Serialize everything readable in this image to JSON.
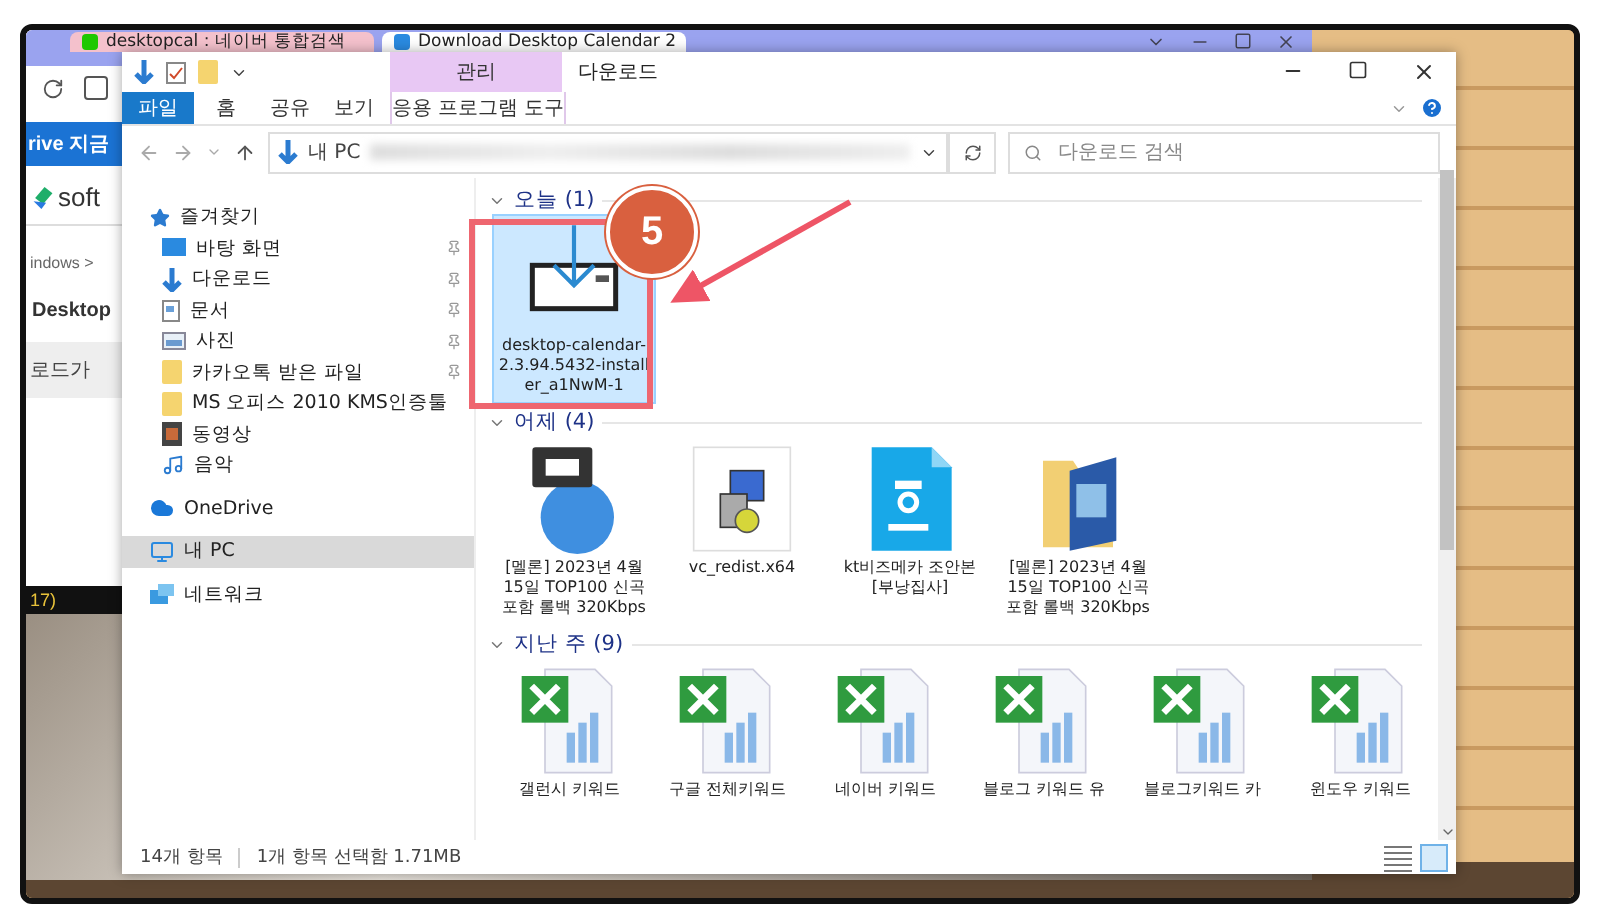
{
  "browser": {
    "tabs": [
      {
        "label": "desktopcal : 네이버 통합검색",
        "selected": false
      },
      {
        "label": "Download Desktop Calendar 2",
        "selected": true
      }
    ],
    "page_texts": [
      {
        "kind": "banner",
        "text": "rive 지금"
      },
      {
        "kind": "logo",
        "text": "soft"
      },
      {
        "kind": "crumb",
        "text": "indows >"
      },
      {
        "kind": "heading",
        "text": "Desktop"
      },
      {
        "kind": "notice",
        "text": "로드가"
      },
      {
        "kind": "strip",
        "text": "17)"
      }
    ]
  },
  "explorer": {
    "title": "다운로드",
    "context_group": "관리",
    "ribbon_tabs": [
      {
        "label": "파일",
        "kind": "file"
      },
      {
        "label": "홈",
        "kind": "normal"
      },
      {
        "label": "공유",
        "kind": "normal"
      },
      {
        "label": "보기",
        "kind": "normal"
      },
      {
        "label": "응용 프로그램 도구",
        "kind": "context"
      }
    ],
    "address": {
      "root": "내 PC"
    },
    "search": {
      "placeholder": "다운로드 검색"
    },
    "nav": [
      {
        "label": "즐겨찾기",
        "kind": "star",
        "selected": false,
        "children": [
          {
            "label": "바탕 화면",
            "kind": "desktop",
            "pinned": true,
            "selected": false
          },
          {
            "label": "다운로드",
            "kind": "download",
            "pinned": true,
            "selected": false
          },
          {
            "label": "문서",
            "kind": "document",
            "pinned": true,
            "selected": false
          },
          {
            "label": "사진",
            "kind": "picture",
            "pinned": true,
            "selected": false
          },
          {
            "label": "카카오톡 받은 파일",
            "kind": "folder",
            "pinned": true,
            "selected": false
          },
          {
            "label": "MS 오피스 2010 KMS인증툴",
            "kind": "folder",
            "pinned": false,
            "selected": false
          },
          {
            "label": "동영상",
            "kind": "video",
            "pinned": false,
            "selected": false
          },
          {
            "label": "음악",
            "kind": "music",
            "pinned": false,
            "selected": false
          }
        ]
      },
      {
        "label": "OneDrive",
        "kind": "cloud",
        "selected": false
      },
      {
        "label": "내 PC",
        "kind": "pc",
        "selected": true
      },
      {
        "label": "네트워크",
        "kind": "network",
        "selected": false
      }
    ],
    "groups": [
      {
        "title": "오늘 (1)",
        "expanded": true,
        "items": [
          {
            "name": "desktop-calendar-2.3.94.5432-installer_a1NwM-1",
            "kind": "installer",
            "selected": true
          }
        ]
      },
      {
        "title": "어제 (4)",
        "expanded": true,
        "items": [
          {
            "name": "[멜론] 2023년 4월 15일 TOP100 신곡포함 롤백 320Kbps",
            "kind": "zip",
            "selected": false
          },
          {
            "name": "vc_redist.x64",
            "kind": "setup",
            "selected": false
          },
          {
            "name": "kt비즈메카 조안본[부낭집사]",
            "kind": "hwp",
            "selected": false
          },
          {
            "name": "[멜론] 2023년 4월 15일 TOP100 신곡포함 롤백 320Kbps",
            "kind": "folder",
            "selected": false
          }
        ]
      },
      {
        "title": "지난 주 (9)",
        "expanded": true,
        "items": [
          {
            "name": "갤런시 키워드",
            "kind": "excel",
            "selected": false
          },
          {
            "name": "구글 전체키워드",
            "kind": "excel",
            "selected": false
          },
          {
            "name": "네이버 키워드",
            "kind": "excel",
            "selected": false
          },
          {
            "name": "블로그 키워드 유",
            "kind": "excel",
            "selected": false
          },
          {
            "name": "블로그키워드 카",
            "kind": "excel",
            "selected": false
          },
          {
            "name": "윈도우 키워드",
            "kind": "excel",
            "selected": false
          }
        ]
      }
    ],
    "status": {
      "count": "14개 항목",
      "selection": "1개 항목 선택함 1.71MB"
    }
  },
  "annotation": {
    "step": "5"
  }
}
